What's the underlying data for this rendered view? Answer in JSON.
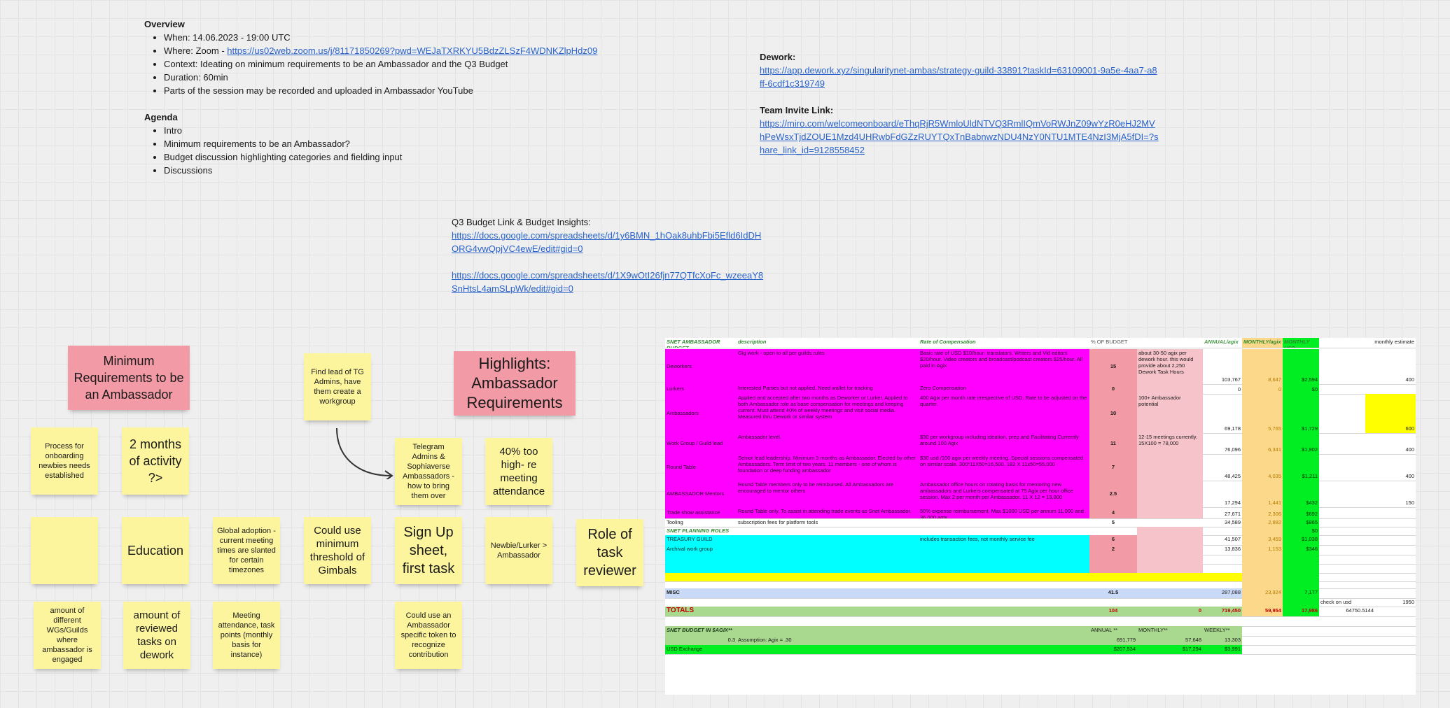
{
  "overview": {
    "heading": "Overview",
    "items": [
      {
        "text": "When: 14.06.2023 - 19:00 UTC"
      },
      {
        "text": "Where: Zoom - ",
        "link": "https://us02web.zoom.us/j/81171850269?pwd=WEJaTXRKYU5BdzZLSzF4WDNKZlpHdz09"
      },
      {
        "text": "Context: Ideating on minimum requirements to be an Ambassador and the Q3 Budget"
      },
      {
        "text": "Duration: 60min"
      },
      {
        "text": "Parts of the session may be recorded and uploaded in Ambassador YouTube"
      }
    ]
  },
  "agenda": {
    "heading": "Agenda",
    "items": [
      "Intro",
      "Minimum requirements to be an Ambassador?",
      "Budget discussion highlighting categories and fielding input",
      "Discussions"
    ]
  },
  "dework": {
    "label": "Dework:",
    "link": "https://app.dework.xyz/singularitynet-ambas/strategy-guild-33891?taskId=63109001-9a5e-4aa7-a8ff-6cdf1c319749"
  },
  "team_invite": {
    "label": "Team Invite Link:",
    "link": "https://miro.com/welcomeonboard/eThqRjR5WmloUldNTVQ3RmlIQmVoRWJnZ09wYzR0eHJ2MVhPeWsxTjdZOUE1Mzd4UHRwbFdGZzRUYTQxTnBabnwzNDU4NzY0NTU1MTE4NzI3MjA5fDI=?share_link_id=9128558452"
  },
  "budget": {
    "label": "Q3 Budget Link & Budget Insights:",
    "link1": "https://docs.google.com/spreadsheets/d/1y6BMN_1hOak8uhbFbi5Efld6IdDHORG4vwQpjVC4ewE/edit#gid=0",
    "link2": "https://docs.google.com/spreadsheets/d/1X9wOtI26fjn77QTfcXoFc_wzeeaY8SnHtsL4amSLpWk/edit#gid=0"
  },
  "notes": {
    "min_req": "Minimum Requirements to be an Ambassador",
    "process": "Process for onboarding newbies needs established",
    "two_months": "2 months of activity ?>",
    "find_lead": "Find lead of TG Admins, have them create a workgroup",
    "highlights": "Highlights: Ambassador Requirements",
    "telegram": "Telegram Admins & Sophiaverse Ambassadors - how to bring them over",
    "forty_pct": "40% too high- re meeting attendance",
    "education": "Education",
    "global": "Global adoption - current meeting times are slanted for certain timezones",
    "threshold": "Could use minimum threshold of Gimbals",
    "signup": "Sign Up sheet, first task",
    "newbie": "Newbie/Lurker > Ambassador",
    "role": "Role of task reviewer",
    "amount_wg": "amount of different WGs/Guilds where ambassador is engaged",
    "amount_tasks": "amount of reviewed tasks on dework",
    "meeting": "Meeting attendance, task points (monthly basis for instance)",
    "token": "Could use an Ambassador specific token to recognize contribution"
  },
  "sheet": {
    "headers": [
      "SNET AMBASSADOR BUDGET",
      "description",
      "Rate of Compensation",
      "% OF BUDGET",
      "",
      "ANNUAL/agix",
      "MONTHLY/agix",
      "MONTHLY USD",
      "",
      "monthly estimate"
    ],
    "rows": [
      {
        "name": "Deworkers",
        "desc": "Gig work - open to all per guilds rules",
        "rate": "Basic rate of USD $10/hour- translators, Writers and Vid editors $20/hour. Video creators and broadcast/podcast creators $25/hour.  All paid in Agix",
        "pct": "15",
        "note": "about 30-50 agix per dework hour. this would provide about 2,250 Dework Task Hours",
        "annual": "103,767",
        "monthly": "8,647",
        "usd": "$2,594",
        "est": "400"
      },
      {
        "name": "Lurkers",
        "desc": "Interested Parties but not applied. Need wallet for tracking",
        "rate": "Zero Compensation",
        "pct": "0",
        "note": "",
        "annual": "0",
        "monthly": "0",
        "usd": "$0",
        "est": ""
      },
      {
        "name": "Ambassadors",
        "desc": "Applied and accepted after two months as Deworker or Lurker. Applied to both Ambassador role as base compensation for meetings and keeping current. Must attend 40% of weekly meetings and visit social media. Measured thru Dework or similar system",
        "rate": "400 Agix per month rate irrespective of USD. Rate to be adjusted on the quarter.",
        "pct": "10",
        "note": "100+ Ambassador potential",
        "annual": "69,178",
        "monthly": "5,765",
        "usd": "$1,729",
        "est": "600"
      },
      {
        "name": "Work Group / Guild lead",
        "desc": "Ambassador level.",
        "rate": "$30 per workgroup including ideation, prep and Facilitating Currently around 100 Agix",
        "pct": "11",
        "note": "12-15 meetings currently. 15X100 = 78,000",
        "annual": "76,096",
        "monthly": "6,341",
        "usd": "$1,902",
        "est": "400"
      },
      {
        "name": "Round Table",
        "desc": "Senior lead leadership. Minimum 3 months as Ambassador. Elected by other Ambassadors. Term limit of two years. 11 members - one of whom is foundation or deep funding ambassador",
        "rate": "$30 usd /100 agix per weekly meeting. Special sessions compensated on similar scale. 300*11X50=16,500. 182 X 11x50=55,000",
        "pct": "7",
        "note": "",
        "annual": "48,425",
        "monthly": "4,035",
        "usd": "$1,211",
        "est": "400"
      },
      {
        "name": "AMBASSADOR Mentors",
        "desc": "Round Table members only to be reimbursed. All Ambassadors are encouraged to mentor others",
        "rate": "Ambassador office hours on rotating basis for mentoring new ambassadors and Lurkers compensated at 75 Agix per hour office session. Max 2 per month per Ambassador. 11 X 12 = 19,800",
        "pct": "2.5",
        "note": "",
        "annual": "17,294",
        "monthly": "1,441",
        "usd": "$432",
        "est": "150"
      },
      {
        "name": "Trade show assistance",
        "desc": "Round Table only. To assist in attending trade events as Snet Ambassador.",
        "rate": "50% expense reimbursement.  Max $1000 USD per annum 11,000 and 36,000 agix",
        "pct": "4",
        "note": "",
        "annual": "27,671",
        "monthly": "2,306",
        "usd": "$692",
        "est": ""
      },
      {
        "name": "Tooling",
        "desc": "subscription fees for platform tools",
        "rate": "",
        "pct": "5",
        "note": "",
        "annual": "34,589",
        "monthly": "2,882",
        "usd": "$865",
        "est": ""
      }
    ],
    "planning_label": "SNET PLANNING ROLES",
    "planning_usd": "$0",
    "cyan_rows": [
      {
        "name": "TREASURY GUILD",
        "rate": "includes transaction fees, not monthly service fee",
        "pct": "6",
        "annual": "41,507",
        "monthly": "3,459",
        "usd": "$1,038"
      },
      {
        "name": "Archival work group",
        "rate": "",
        "pct": "2",
        "annual": "13,836",
        "monthly": "1,153",
        "usd": "$346"
      }
    ],
    "misc": {
      "name": "MISC",
      "pct": "41.5",
      "annual": "287,088",
      "monthly": "23,924",
      "usd": "7,177"
    },
    "check": {
      "label": "check on usd",
      "value": "1950"
    },
    "totals": {
      "name": "TOTALS",
      "pct": "104",
      "zero": "0",
      "annual": "719,450",
      "monthly": "59,954",
      "usd": "17,986",
      "extra": "64750.5144"
    },
    "budget_section": {
      "title": "SNET BUDGET IN $AGIX**",
      "cols": [
        "ANNUAL **",
        "MONTHLY**",
        "WEEKLY**"
      ],
      "assumption_num": "0.3",
      "assumption": "Assumption: Agix = .30",
      "values": [
        "691,779",
        "57,648",
        "13,303"
      ],
      "usd_label": "USD Exchange",
      "usd_values": [
        "$207,534",
        "$17,294",
        "$3,991"
      ]
    }
  },
  "colors": {
    "sticky_yellow": "#fdf59e",
    "sticky_pink": "#f29aa5",
    "link": "#2a63c9",
    "magenta": "#ff00ff",
    "cyan": "#00ffff",
    "green": "#00ee22"
  }
}
